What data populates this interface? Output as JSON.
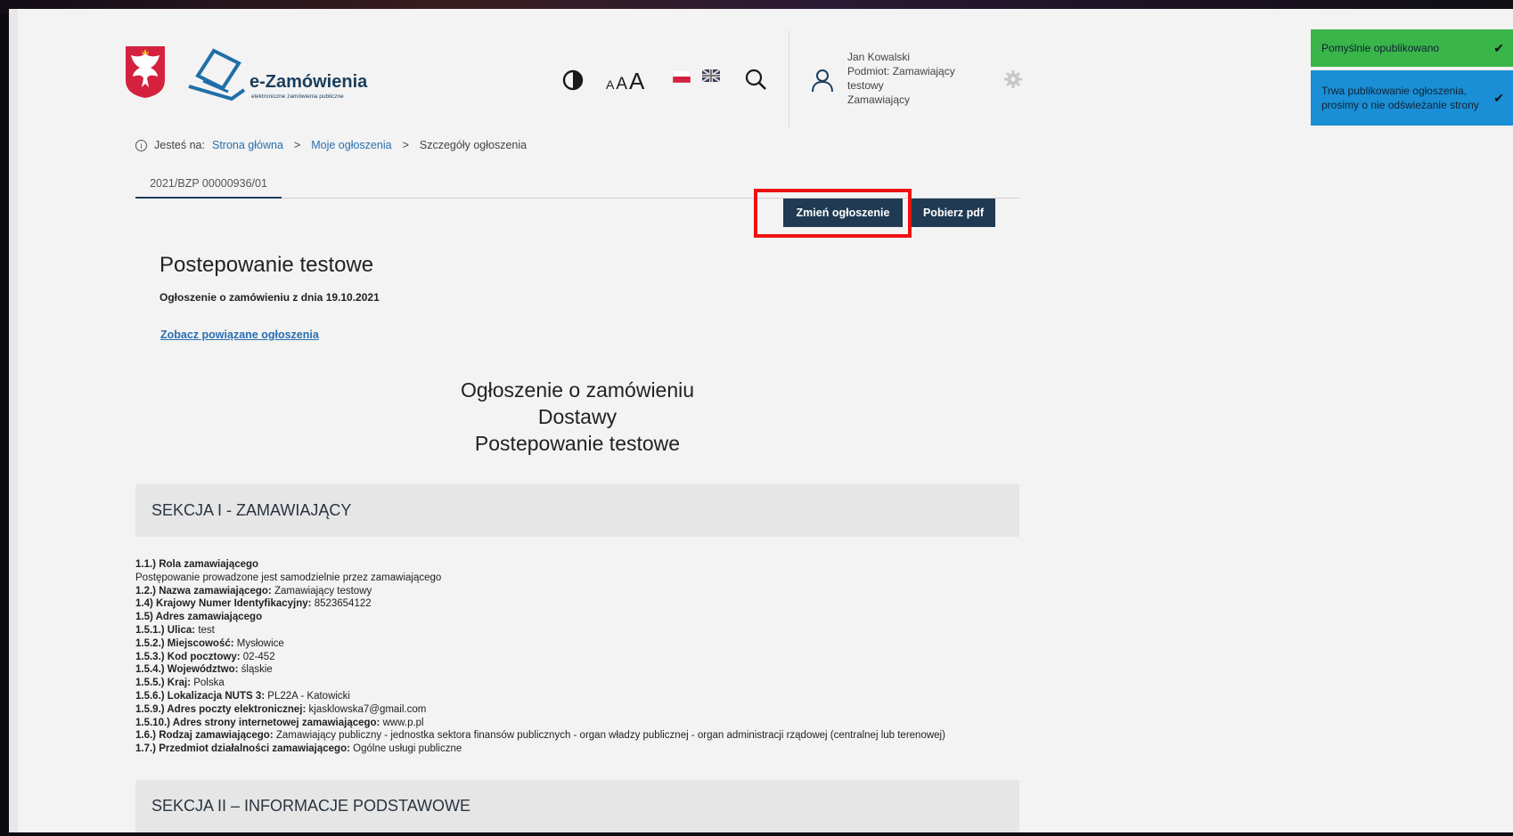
{
  "header": {
    "brand_name": "e-Zamówienia",
    "brand_tagline": "elektroniczne zamówienia publiczne",
    "font_size_labels": [
      "A",
      "A",
      "A"
    ],
    "user": {
      "name": "Jan Kowalski",
      "entity_line1": "Podmiot: Zamawiający",
      "entity_line2": "testowy",
      "role": "Zamawiający"
    }
  },
  "toasts": {
    "success": "Pomyślnie opublikowano",
    "info": "Trwa publikowanie ogłoszenia, prosimy o nie odświeżanie strony"
  },
  "breadcrumb": {
    "prefix": "Jesteś na:",
    "home": "Strona główna",
    "my_notices": "Moje ogłoszenia",
    "current": "Szczegóły ogłoszenia",
    "separator": ">"
  },
  "tab": {
    "label": "2021/BZP 00000936/01"
  },
  "actions": {
    "change_label": "Zmień ogłoszenie",
    "pdf_label": "Pobierz pdf",
    "highlight_color": "#ee1111"
  },
  "notice": {
    "title": "Postepowanie testowe",
    "date_line": "Ogłoszenie o zamówieniu z dnia 19.10.2021",
    "related_link": "Zobacz powiązane ogłoszenia",
    "heading_line1": "Ogłoszenie o zamówieniu",
    "heading_line2": "Dostawy",
    "heading_line3": "Postepowanie testowe"
  },
  "section1": {
    "title": "SEKCJA I - ZAMAWIAJĄCY",
    "rows": [
      {
        "label": "1.1.) Rola zamawiającego",
        "value": ""
      },
      {
        "label": "",
        "value": "Postępowanie prowadzone jest samodzielnie przez zamawiającego"
      },
      {
        "label": "1.2.) Nazwa zamawiającego:",
        "value": "Zamawiający testowy"
      },
      {
        "label": "1.4) Krajowy Numer Identyfikacyjny:",
        "value": "8523654122"
      },
      {
        "label": "1.5) Adres zamawiającego",
        "value": ""
      },
      {
        "label": "1.5.1.) Ulica:",
        "value": "test"
      },
      {
        "label": "1.5.2.) Miejscowość:",
        "value": "Mysłowice"
      },
      {
        "label": "1.5.3.) Kod pocztowy:",
        "value": "02-452"
      },
      {
        "label": "1.5.4.) Województwo:",
        "value": "śląskie"
      },
      {
        "label": "1.5.5.) Kraj:",
        "value": "Polska"
      },
      {
        "label": "1.5.6.) Lokalizacja NUTS 3:",
        "value": "PL22A - Katowicki"
      },
      {
        "label": "1.5.9.) Adres poczty elektronicznej:",
        "value": "kjasklowska7@gmail.com"
      },
      {
        "label": "1.5.10.) Adres strony internetowej zamawiającego:",
        "value": "www.p.pl"
      },
      {
        "label": "1.6.) Rodzaj zamawiającego:",
        "value": "Zamawiający publiczny - jednostka sektora finansów publicznych - organ władzy publicznej - organ administracji rządowej (centralnej lub terenowej)"
      },
      {
        "label": "1.7.) Przedmiot działalności zamawiającego:",
        "value": "Ogólne usługi publiczne"
      }
    ]
  },
  "section2": {
    "title": "SEKCJA II – INFORMACJE PODSTAWOWE"
  },
  "colors": {
    "primary_dark": "#1f3a52",
    "link": "#2a6fb0",
    "toast_success": "#39b54a",
    "toast_info": "#1a8fd6"
  }
}
